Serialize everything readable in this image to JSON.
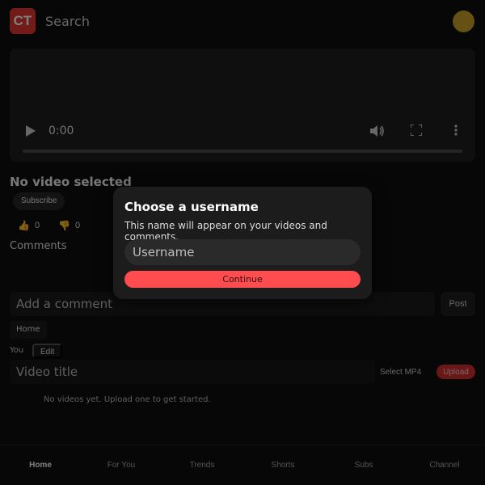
{
  "header": {
    "logo_text": "CT",
    "search_placeholder": "Search",
    "brand_color": "#e53935",
    "avatar_color": "#c9a227"
  },
  "player": {
    "time": "0:00",
    "icons": [
      "play-icon",
      "volume-icon",
      "fullscreen-icon",
      "more-icon"
    ]
  },
  "video": {
    "title": "No video selected",
    "subscribe_label": "Subscribe",
    "likes": "0",
    "dislikes": "0"
  },
  "comments": {
    "label": "Comments",
    "input_placeholder": "Add a comment",
    "post_label": "Post"
  },
  "channel": {
    "home_chip": "Home",
    "you_label": "You",
    "edit_label": "Edit"
  },
  "upload": {
    "title_placeholder": "Video title",
    "select_label": "Select MP4",
    "upload_label": "Upload",
    "empty_message": "No videos yet. Upload one to get started."
  },
  "bottom_nav": {
    "items": [
      "Home",
      "For You",
      "Trends",
      "Shorts",
      "Subs",
      "Channel"
    ],
    "active": "Home"
  },
  "modal": {
    "title": "Choose a username",
    "description": "This name will appear on your videos and comments.",
    "input_placeholder": "Username",
    "button_label": "Continue",
    "button_color": "#ff4d4f"
  }
}
